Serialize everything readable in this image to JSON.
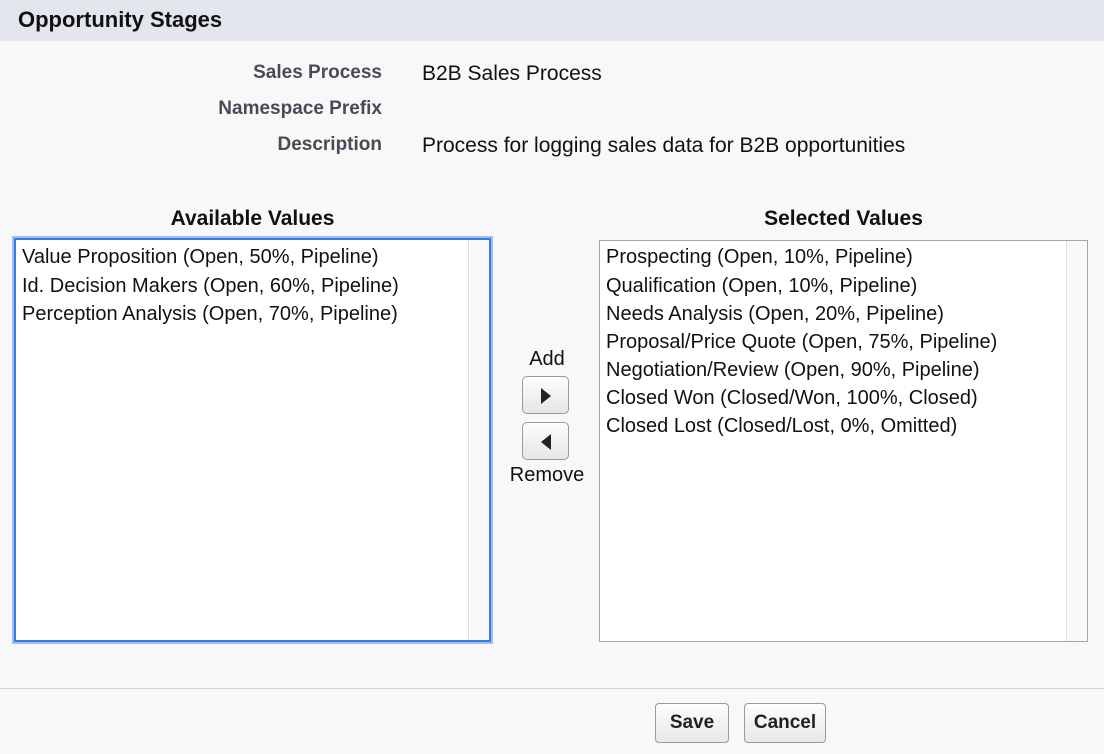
{
  "header": {
    "title": "Opportunity Stages"
  },
  "fields": {
    "sales_process_label": "Sales Process",
    "sales_process_value": "B2B Sales Process",
    "namespace_prefix_label": "Namespace Prefix",
    "namespace_prefix_value": "",
    "description_label": "Description",
    "description_value": "Process for logging sales data for B2B opportunities"
  },
  "available": {
    "title": "Available Values",
    "items": [
      "Value Proposition (Open, 50%, Pipeline)",
      "Id. Decision Makers (Open, 60%, Pipeline)",
      "Perception Analysis (Open, 70%, Pipeline)"
    ]
  },
  "selected": {
    "title": "Selected Values",
    "items": [
      "Prospecting (Open, 10%, Pipeline)",
      "Qualification (Open, 10%, Pipeline)",
      "Needs Analysis (Open, 20%, Pipeline)",
      "Proposal/Price Quote (Open, 75%, Pipeline)",
      "Negotiation/Review (Open, 90%, Pipeline)",
      "Closed Won (Closed/Won, 100%, Closed)",
      "Closed Lost (Closed/Lost, 0%, Omitted)"
    ]
  },
  "controls": {
    "add_label": "Add",
    "remove_label": "Remove",
    "add_icon": "arrow-right-icon",
    "remove_icon": "arrow-left-icon"
  },
  "footer": {
    "save_label": "Save",
    "cancel_label": "Cancel"
  }
}
